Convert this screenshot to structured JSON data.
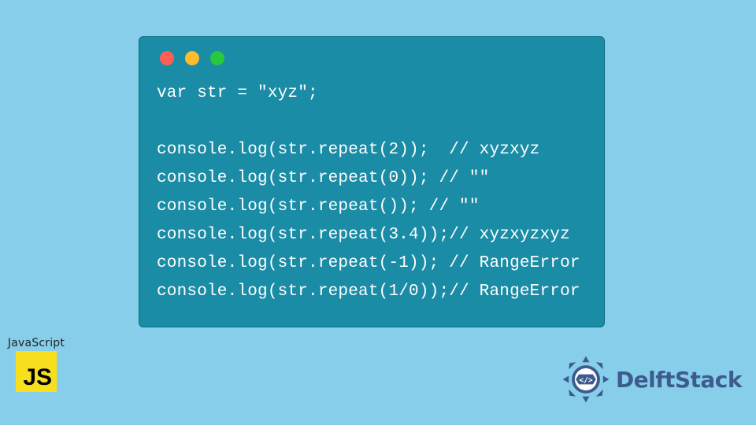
{
  "code": {
    "lines": [
      "var str = \"xyz\";",
      "",
      "console.log(str.repeat(2));  // xyzxyz",
      "console.log(str.repeat(0)); // \"\"",
      "console.log(str.repeat()); // \"\"",
      "console.log(str.repeat(3.4));// xyzxyzxyz",
      "console.log(str.repeat(-1)); // RangeError",
      "console.log(str.repeat(1/0));// RangeError"
    ]
  },
  "js_badge": {
    "label": "JavaScript",
    "j": "J",
    "s": "S"
  },
  "brand": {
    "name": "DelftStack"
  },
  "colors": {
    "bg": "#87ceeb",
    "codeBg": "#1b8ca6",
    "jsYellow": "#f7df1e",
    "brandBlue": "#3d5b8c"
  }
}
